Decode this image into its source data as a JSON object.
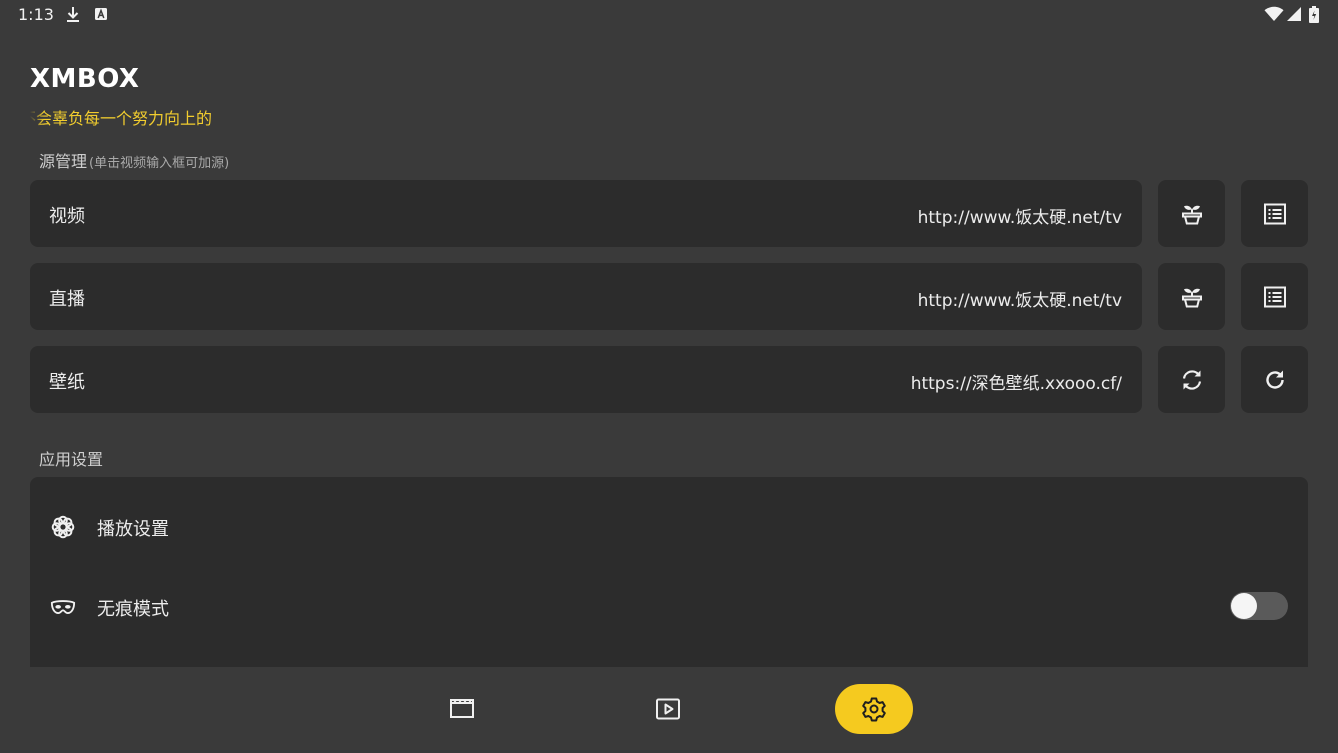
{
  "status_bar": {
    "time": "1:13",
    "left_icons": [
      "download-icon",
      "keyboard-a-icon"
    ],
    "right_icons": [
      "wifi-icon",
      "cell-signal-icon",
      "battery-icon"
    ]
  },
  "app": {
    "title": "XMBOX",
    "marquee": "不会辜负每一个努力向上的",
    "accent_color": "#f5ca1f",
    "marquee_color": "#f2cd2e"
  },
  "source_section": {
    "title": "源管理",
    "hint": "(单击视频输入框可加源)",
    "rows": [
      {
        "label": "视频",
        "url": "http://www.饭太硬.net/tv",
        "buttons": [
          "plant-pot-icon",
          "list-icon"
        ]
      },
      {
        "label": "直播",
        "url": "http://www.饭太硬.net/tv",
        "buttons": [
          "plant-pot-icon",
          "list-icon"
        ]
      },
      {
        "label": "壁纸",
        "url": "https://深色壁纸.xxooo.cf/",
        "buttons": [
          "sync-icon",
          "refresh-icon"
        ]
      }
    ]
  },
  "app_settings": {
    "title": "应用设置",
    "items": [
      {
        "label": "播放设置",
        "icon": "flower-icon"
      },
      {
        "label": "无痕模式",
        "icon": "mask-icon",
        "toggle": false
      }
    ]
  },
  "bottom_nav": {
    "items": [
      {
        "name": "vod",
        "icon": "clapperboard-icon",
        "active": false
      },
      {
        "name": "live",
        "icon": "play-icon",
        "active": false
      },
      {
        "name": "settings",
        "icon": "gear-icon",
        "active": true
      }
    ]
  }
}
